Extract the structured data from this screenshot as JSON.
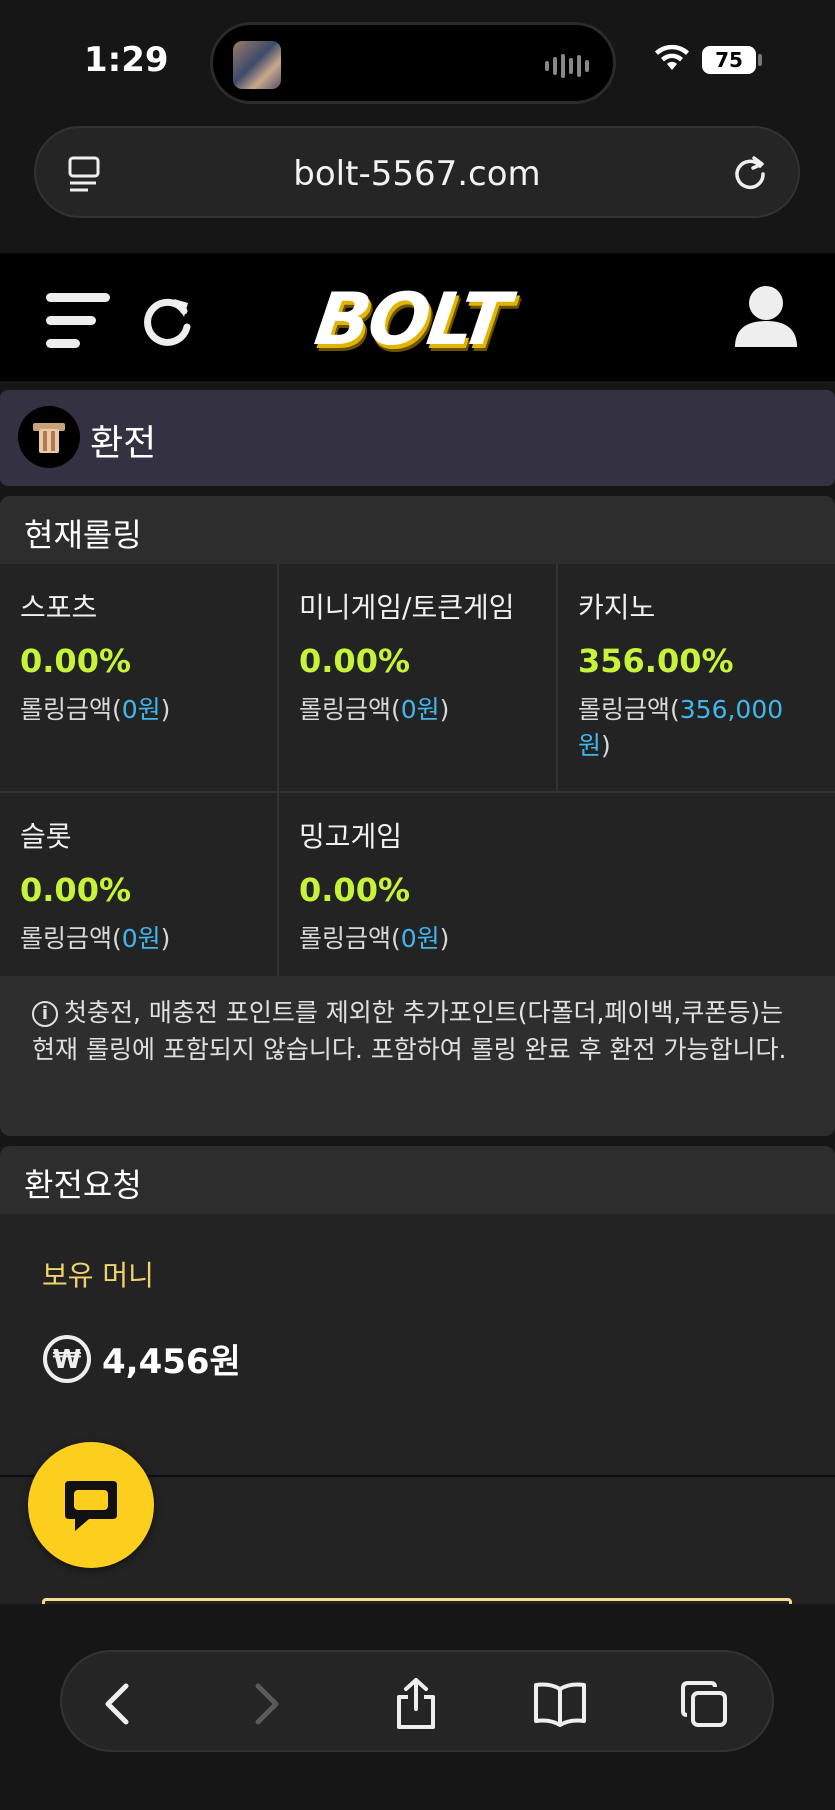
{
  "status": {
    "time": "1:29",
    "battery": "75"
  },
  "browser": {
    "url": "bolt-5567.com"
  },
  "site": {
    "logo": "BOLT"
  },
  "section": {
    "title": "환전"
  },
  "rolling": {
    "title": "현재롤링",
    "amount_label": "롤링금액(",
    "amount_close": ")",
    "items": [
      {
        "name": "스포츠",
        "percent": "0.00%",
        "amount": "0원"
      },
      {
        "name": "미니게임/토큰게임",
        "percent": "0.00%",
        "amount": "0원"
      },
      {
        "name": "카지노",
        "percent": "356.00%",
        "amount": "356,000",
        "amount_suffix": "원"
      },
      {
        "name": "슬롯",
        "percent": "0.00%",
        "amount": "0원"
      },
      {
        "name": "밍고게임",
        "percent": "0.00%",
        "amount": "0원"
      }
    ],
    "notice": "첫충전, 매충전 포인트를 제외한 추가포인트(다폴더,페이백,쿠폰등)는 현재 롤링에 포함되지 않습니다. 포함하여 롤링 완료 후 환전 가능합니다."
  },
  "request": {
    "title": "환전요청",
    "holding_label": "보유 머니",
    "holding_amount": "4,456원"
  },
  "colors": {
    "accent_green": "#c6f43b",
    "accent_blue": "#42b6ec",
    "accent_gold": "#f0d36c",
    "chat_yellow": "#fccf1f"
  }
}
